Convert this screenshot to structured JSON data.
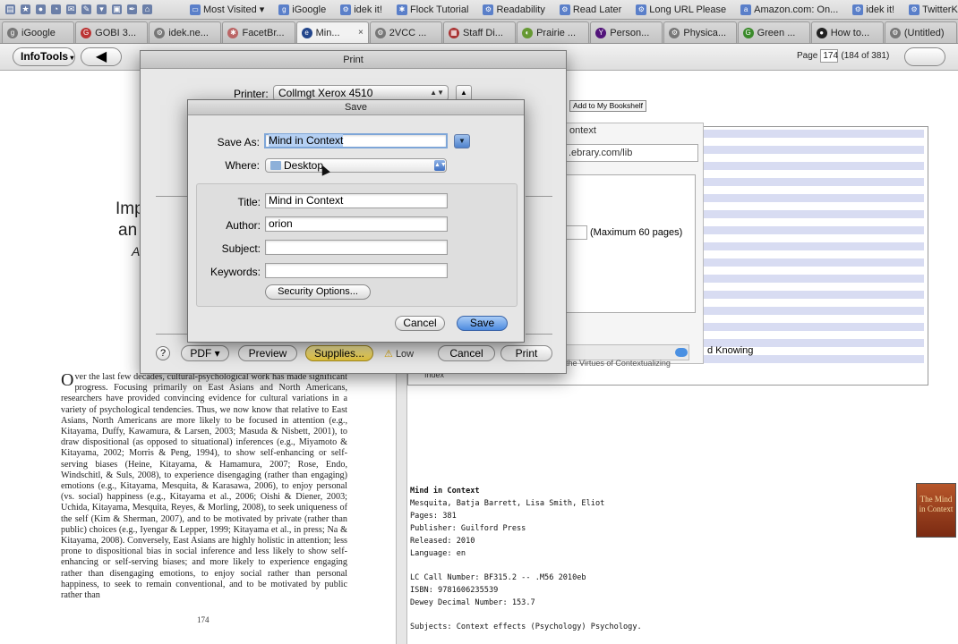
{
  "bookmarks_bar": {
    "items": [
      {
        "label": "Most Visited ▾",
        "icon": "folder-icon"
      },
      {
        "label": "iGoogle",
        "icon": "google-icon"
      },
      {
        "label": "idek it!",
        "icon": "gear-icon"
      },
      {
        "label": "Flock Tutorial",
        "icon": "flock-icon"
      },
      {
        "label": "Readability",
        "icon": "gear-icon"
      },
      {
        "label": "Read Later",
        "icon": "gear-icon"
      },
      {
        "label": "Long URL Please",
        "icon": "gear-icon"
      },
      {
        "label": "Amazon.com: On...",
        "icon": "amazon-icon"
      },
      {
        "label": "idek it!",
        "icon": "gear-icon"
      },
      {
        "label": "TwitterKeys",
        "icon": "gear-icon"
      }
    ]
  },
  "tabs": [
    {
      "label": "iGoogle",
      "active": false
    },
    {
      "label": "GOBI 3...",
      "active": false
    },
    {
      "label": "idek.ne...",
      "active": false
    },
    {
      "label": "FacetBr...",
      "active": false
    },
    {
      "label": "Min...",
      "active": true,
      "close": "×"
    },
    {
      "label": "2VCC ...",
      "active": false
    },
    {
      "label": "Staff Di...",
      "active": false
    },
    {
      "label": "Prairie ...",
      "active": false
    },
    {
      "label": "Person...",
      "active": false
    },
    {
      "label": "Physica...",
      "active": false
    },
    {
      "label": "Green ...",
      "active": false
    },
    {
      "label": "How to...",
      "active": false
    },
    {
      "label": "(Untitled)",
      "active": false
    }
  ],
  "toolbar": {
    "infotools_label": "InfoTools",
    "back_symbol": "◀",
    "page_label": "Page",
    "page_value": "174",
    "page_of": "(184 of 381)"
  },
  "book": {
    "heading_frag_1": "Imp",
    "heading_frag_2": "an",
    "heading_frag_3": "A",
    "dropcap": "O",
    "body": "ver the last few decades, cultural-psychological work has made significant progress. Focusing primarily on East Asians and North Americans, researchers have provided convincing evidence for cultural variations in a variety of psychological tendencies. Thus, we now know that relative to East Asians, North Americans are more likely to be focused in attention (e.g., Kitayama, Duffy, Kawamura, & Larsen, 2003; Masuda & Nisbett, 2001), to draw dispositional (as opposed to situational) inferences (e.g., Miyamoto & Kitayama, 2002; Morris & Peng, 1994), to show self-enhancing or self-serving biases (Heine, Kitayama, & Hamamura, 2007; Rose, Endo, Windschitl, & Suls, 2008), to experience disengaging (rather than engaging) emotions (e.g., Kitayama, Mesquita, & Karasawa, 2006), to enjoy personal (vs. social) happiness (e.g., Kitayama et al., 2006; Oishi & Diener, 2003; Uchida, Kitayama, Mesquita, Reyes, & Morling, 2008), to seek uniqueness of the self (Kim & Sherman, 2007), and to be motivated by private (rather than public) choices (e.g., Iyengar & Lepper, 1999; Kitayama et al., in press; Na & Kitayama, 2008). Conversely, East Asians are highly holistic in attention; less prone to dispositional bias in social inference and less likely to show self-enhancing or self-serving biases; and more likely to experience engaging rather than disengaging emotions, to enjoy social rather than personal happiness, to seek to remain conventional, and to be motivated by public rather than",
    "page_number": "174"
  },
  "ebrary": {
    "add_bookshelf": "Add to My Bookshelf",
    "popup_title": "ontext",
    "url": ".ebrary.com/lib",
    "max_pages": "(Maximum 60 pages)",
    "knowing": "d Knowing",
    "virtues": "the Virtues of Contextualizing",
    "index": "Index"
  },
  "metadata": {
    "title": "Mind in Context",
    "authors": "Mesquita, Batja Barrett, Lisa Smith, Eliot",
    "pages": "Pages: 381",
    "publisher": "Publisher: Guilford Press",
    "released": "Released: 2010",
    "language": "Language: en",
    "lc_call": "LC Call Number: BF315.2 -- .M56 2010eb",
    "isbn": "ISBN: 9781606235539",
    "dewey": "Dewey Decimal Number: 153.7",
    "subjects": "Subjects: Context effects (Psychology)   Psychology.",
    "cover_text": "The Mind in Context"
  },
  "print_dialog": {
    "title": "Print",
    "printer_label": "Printer:",
    "printer_value": "Collmgt Xerox 4510",
    "help": "?",
    "pdf_label": "PDF ▾",
    "preview_label": "Preview",
    "supplies_label": "Supplies...",
    "low_label": "Low",
    "cancel_label": "Cancel",
    "print_label": "Print"
  },
  "save_dialog": {
    "title": "Save",
    "save_as_label": "Save As:",
    "save_as_value": "Mind in Context",
    "where_label": "Where:",
    "where_value": "Desktop",
    "title_label": "Title:",
    "title_value": "Mind in Context",
    "author_label": "Author:",
    "author_value": "orion",
    "subject_label": "Subject:",
    "subject_value": "",
    "keywords_label": "Keywords:",
    "keywords_value": "",
    "security_label": "Security Options...",
    "cancel_label": "Cancel",
    "save_label": "Save"
  }
}
